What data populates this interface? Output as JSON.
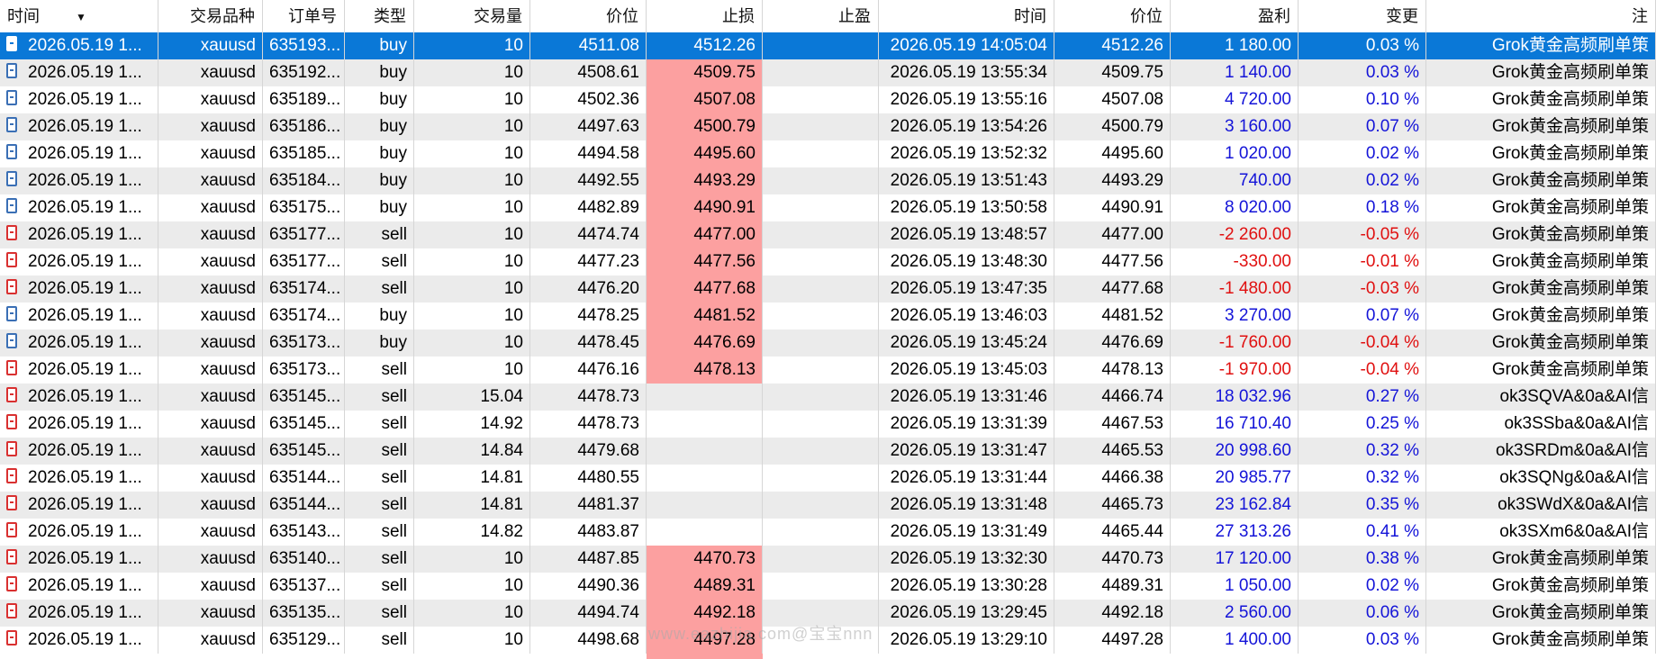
{
  "columns": [
    {
      "key": "time",
      "label": "时间",
      "w": 176,
      "align": "left"
    },
    {
      "key": "symbol",
      "label": "交易品种",
      "w": 116,
      "align": "right"
    },
    {
      "key": "order",
      "label": "订单号",
      "w": 91,
      "align": "right"
    },
    {
      "key": "type",
      "label": "类型",
      "w": 77,
      "align": "right"
    },
    {
      "key": "volume",
      "label": "交易量",
      "w": 129,
      "align": "right"
    },
    {
      "key": "price",
      "label": "价位",
      "w": 129,
      "align": "right"
    },
    {
      "key": "sl",
      "label": "止损",
      "w": 129,
      "align": "right"
    },
    {
      "key": "tp",
      "label": "止盈",
      "w": 129,
      "align": "right"
    },
    {
      "key": "close_time",
      "label": "时间",
      "w": 195,
      "align": "right"
    },
    {
      "key": "close_price",
      "label": "价位",
      "w": 129,
      "align": "right"
    },
    {
      "key": "profit",
      "label": "盈利",
      "w": 142,
      "align": "right"
    },
    {
      "key": "change",
      "label": "变更",
      "w": 142,
      "align": "right"
    },
    {
      "key": "comment",
      "label": "注",
      "w": 255,
      "align": "right"
    }
  ],
  "sort_indicator": "▼",
  "colors": {
    "selected": "#0a78d7",
    "sl_highlight": "#fca0a0",
    "positive": "#1414d8",
    "negative": "#e01010"
  },
  "rows": [
    {
      "icon": "buy",
      "time": "2026.05.19 1...",
      "symbol": "xauusd",
      "order": "635193...",
      "type": "buy",
      "volume": "10",
      "price": "4511.08",
      "sl": "4512.26",
      "tp": "",
      "close_time": "2026.05.19 14:05:04",
      "close_price": "4512.26",
      "profit": "1 180.00",
      "change": "0.03 %",
      "comment": "Grok黄金高频刷单策",
      "sl_hit": false,
      "selected": true,
      "sign": "pos"
    },
    {
      "icon": "buy",
      "time": "2026.05.19 1...",
      "symbol": "xauusd",
      "order": "635192...",
      "type": "buy",
      "volume": "10",
      "price": "4508.61",
      "sl": "4509.75",
      "tp": "",
      "close_time": "2026.05.19 13:55:34",
      "close_price": "4509.75",
      "profit": "1 140.00",
      "change": "0.03 %",
      "comment": "Grok黄金高频刷单策",
      "sl_hit": true,
      "selected": false,
      "sign": "pos"
    },
    {
      "icon": "buy",
      "time": "2026.05.19 1...",
      "symbol": "xauusd",
      "order": "635189...",
      "type": "buy",
      "volume": "10",
      "price": "4502.36",
      "sl": "4507.08",
      "tp": "",
      "close_time": "2026.05.19 13:55:16",
      "close_price": "4507.08",
      "profit": "4 720.00",
      "change": "0.10 %",
      "comment": "Grok黄金高频刷单策",
      "sl_hit": true,
      "selected": false,
      "sign": "pos"
    },
    {
      "icon": "buy",
      "time": "2026.05.19 1...",
      "symbol": "xauusd",
      "order": "635186...",
      "type": "buy",
      "volume": "10",
      "price": "4497.63",
      "sl": "4500.79",
      "tp": "",
      "close_time": "2026.05.19 13:54:26",
      "close_price": "4500.79",
      "profit": "3 160.00",
      "change": "0.07 %",
      "comment": "Grok黄金高频刷单策",
      "sl_hit": true,
      "selected": false,
      "sign": "pos"
    },
    {
      "icon": "buy",
      "time": "2026.05.19 1...",
      "symbol": "xauusd",
      "order": "635185...",
      "type": "buy",
      "volume": "10",
      "price": "4494.58",
      "sl": "4495.60",
      "tp": "",
      "close_time": "2026.05.19 13:52:32",
      "close_price": "4495.60",
      "profit": "1 020.00",
      "change": "0.02 %",
      "comment": "Grok黄金高频刷单策",
      "sl_hit": true,
      "selected": false,
      "sign": "pos"
    },
    {
      "icon": "buy",
      "time": "2026.05.19 1...",
      "symbol": "xauusd",
      "order": "635184...",
      "type": "buy",
      "volume": "10",
      "price": "4492.55",
      "sl": "4493.29",
      "tp": "",
      "close_time": "2026.05.19 13:51:43",
      "close_price": "4493.29",
      "profit": "740.00",
      "change": "0.02 %",
      "comment": "Grok黄金高频刷单策",
      "sl_hit": true,
      "selected": false,
      "sign": "pos"
    },
    {
      "icon": "buy",
      "time": "2026.05.19 1...",
      "symbol": "xauusd",
      "order": "635175...",
      "type": "buy",
      "volume": "10",
      "price": "4482.89",
      "sl": "4490.91",
      "tp": "",
      "close_time": "2026.05.19 13:50:58",
      "close_price": "4490.91",
      "profit": "8 020.00",
      "change": "0.18 %",
      "comment": "Grok黄金高频刷单策",
      "sl_hit": true,
      "selected": false,
      "sign": "pos"
    },
    {
      "icon": "sell",
      "time": "2026.05.19 1...",
      "symbol": "xauusd",
      "order": "635177...",
      "type": "sell",
      "volume": "10",
      "price": "4474.74",
      "sl": "4477.00",
      "tp": "",
      "close_time": "2026.05.19 13:48:57",
      "close_price": "4477.00",
      "profit": "-2 260.00",
      "change": "-0.05 %",
      "comment": "Grok黄金高频刷单策",
      "sl_hit": true,
      "selected": false,
      "sign": "neg"
    },
    {
      "icon": "sell",
      "time": "2026.05.19 1...",
      "symbol": "xauusd",
      "order": "635177...",
      "type": "sell",
      "volume": "10",
      "price": "4477.23",
      "sl": "4477.56",
      "tp": "",
      "close_time": "2026.05.19 13:48:30",
      "close_price": "4477.56",
      "profit": "-330.00",
      "change": "-0.01 %",
      "comment": "Grok黄金高频刷单策",
      "sl_hit": true,
      "selected": false,
      "sign": "neg"
    },
    {
      "icon": "sell",
      "time": "2026.05.19 1...",
      "symbol": "xauusd",
      "order": "635174...",
      "type": "sell",
      "volume": "10",
      "price": "4476.20",
      "sl": "4477.68",
      "tp": "",
      "close_time": "2026.05.19 13:47:35",
      "close_price": "4477.68",
      "profit": "-1 480.00",
      "change": "-0.03 %",
      "comment": "Grok黄金高频刷单策",
      "sl_hit": true,
      "selected": false,
      "sign": "neg"
    },
    {
      "icon": "buy",
      "time": "2026.05.19 1...",
      "symbol": "xauusd",
      "order": "635174...",
      "type": "buy",
      "volume": "10",
      "price": "4478.25",
      "sl": "4481.52",
      "tp": "",
      "close_time": "2026.05.19 13:46:03",
      "close_price": "4481.52",
      "profit": "3 270.00",
      "change": "0.07 %",
      "comment": "Grok黄金高频刷单策",
      "sl_hit": true,
      "selected": false,
      "sign": "pos"
    },
    {
      "icon": "buy",
      "time": "2026.05.19 1...",
      "symbol": "xauusd",
      "order": "635173...",
      "type": "buy",
      "volume": "10",
      "price": "4478.45",
      "sl": "4476.69",
      "tp": "",
      "close_time": "2026.05.19 13:45:24",
      "close_price": "4476.69",
      "profit": "-1 760.00",
      "change": "-0.04 %",
      "comment": "Grok黄金高频刷单策",
      "sl_hit": true,
      "selected": false,
      "sign": "neg"
    },
    {
      "icon": "sell",
      "time": "2026.05.19 1...",
      "symbol": "xauusd",
      "order": "635173...",
      "type": "sell",
      "volume": "10",
      "price": "4476.16",
      "sl": "4478.13",
      "tp": "",
      "close_time": "2026.05.19 13:45:03",
      "close_price": "4478.13",
      "profit": "-1 970.00",
      "change": "-0.04 %",
      "comment": "Grok黄金高频刷单策",
      "sl_hit": true,
      "selected": false,
      "sign": "neg"
    },
    {
      "icon": "sell",
      "time": "2026.05.19 1...",
      "symbol": "xauusd",
      "order": "635145...",
      "type": "sell",
      "volume": "15.04",
      "price": "4478.73",
      "sl": "",
      "tp": "",
      "close_time": "2026.05.19 13:31:46",
      "close_price": "4466.74",
      "profit": "18 032.96",
      "change": "0.27 %",
      "comment": "ok3SQVA&0a&AI信",
      "sl_hit": false,
      "selected": false,
      "sign": "pos"
    },
    {
      "icon": "sell",
      "time": "2026.05.19 1...",
      "symbol": "xauusd",
      "order": "635145...",
      "type": "sell",
      "volume": "14.92",
      "price": "4478.73",
      "sl": "",
      "tp": "",
      "close_time": "2026.05.19 13:31:39",
      "close_price": "4467.53",
      "profit": "16 710.40",
      "change": "0.25 %",
      "comment": "ok3SSba&0a&AI信",
      "sl_hit": false,
      "selected": false,
      "sign": "pos"
    },
    {
      "icon": "sell",
      "time": "2026.05.19 1...",
      "symbol": "xauusd",
      "order": "635145...",
      "type": "sell",
      "volume": "14.84",
      "price": "4479.68",
      "sl": "",
      "tp": "",
      "close_time": "2026.05.19 13:31:47",
      "close_price": "4465.53",
      "profit": "20 998.60",
      "change": "0.32 %",
      "comment": "ok3SRDm&0a&AI信",
      "sl_hit": false,
      "selected": false,
      "sign": "pos"
    },
    {
      "icon": "sell",
      "time": "2026.05.19 1...",
      "symbol": "xauusd",
      "order": "635144...",
      "type": "sell",
      "volume": "14.81",
      "price": "4480.55",
      "sl": "",
      "tp": "",
      "close_time": "2026.05.19 13:31:44",
      "close_price": "4466.38",
      "profit": "20 985.77",
      "change": "0.32 %",
      "comment": "ok3SQNg&0a&AI信",
      "sl_hit": false,
      "selected": false,
      "sign": "pos"
    },
    {
      "icon": "sell",
      "time": "2026.05.19 1...",
      "symbol": "xauusd",
      "order": "635144...",
      "type": "sell",
      "volume": "14.81",
      "price": "4481.37",
      "sl": "",
      "tp": "",
      "close_time": "2026.05.19 13:31:48",
      "close_price": "4465.73",
      "profit": "23 162.84",
      "change": "0.35 %",
      "comment": "ok3SWdX&0a&AI信",
      "sl_hit": false,
      "selected": false,
      "sign": "pos"
    },
    {
      "icon": "sell",
      "time": "2026.05.19 1...",
      "symbol": "xauusd",
      "order": "635143...",
      "type": "sell",
      "volume": "14.82",
      "price": "4483.87",
      "sl": "",
      "tp": "",
      "close_time": "2026.05.19 13:31:49",
      "close_price": "4465.44",
      "profit": "27 313.26",
      "change": "0.41 %",
      "comment": "ok3SXm6&0a&AI信",
      "sl_hit": false,
      "selected": false,
      "sign": "pos"
    },
    {
      "icon": "sell",
      "time": "2026.05.19 1...",
      "symbol": "xauusd",
      "order": "635140...",
      "type": "sell",
      "volume": "10",
      "price": "4487.85",
      "sl": "4470.73",
      "tp": "",
      "close_time": "2026.05.19 13:32:30",
      "close_price": "4470.73",
      "profit": "17 120.00",
      "change": "0.38 %",
      "comment": "Grok黄金高频刷单策",
      "sl_hit": true,
      "selected": false,
      "sign": "pos"
    },
    {
      "icon": "sell",
      "time": "2026.05.19 1...",
      "symbol": "xauusd",
      "order": "635137...",
      "type": "sell",
      "volume": "10",
      "price": "4490.36",
      "sl": "4489.31",
      "tp": "",
      "close_time": "2026.05.19 13:30:28",
      "close_price": "4489.31",
      "profit": "1 050.00",
      "change": "0.02 %",
      "comment": "Grok黄金高频刷单策",
      "sl_hit": true,
      "selected": false,
      "sign": "pos"
    },
    {
      "icon": "sell",
      "time": "2026.05.19 1...",
      "symbol": "xauusd",
      "order": "635135...",
      "type": "sell",
      "volume": "10",
      "price": "4494.74",
      "sl": "4492.18",
      "tp": "",
      "close_time": "2026.05.19 13:29:45",
      "close_price": "4492.18",
      "profit": "2 560.00",
      "change": "0.06 %",
      "comment": "Grok黄金高频刷单策",
      "sl_hit": true,
      "selected": false,
      "sign": "pos"
    },
    {
      "icon": "sell",
      "time": "2026.05.19 1...",
      "symbol": "xauusd",
      "order": "635129...",
      "type": "sell",
      "volume": "10",
      "price": "4498.68",
      "sl": "4497.28",
      "tp": "",
      "close_time": "2026.05.19 13:29:10",
      "close_price": "4497.28",
      "profit": "1 400.00",
      "change": "0.03 %",
      "comment": "Grok黄金高频刷单策",
      "sl_hit": true,
      "selected": false,
      "sign": "pos"
    }
  ],
  "watermark": "www.eazhijia.com@宝宝nnn"
}
